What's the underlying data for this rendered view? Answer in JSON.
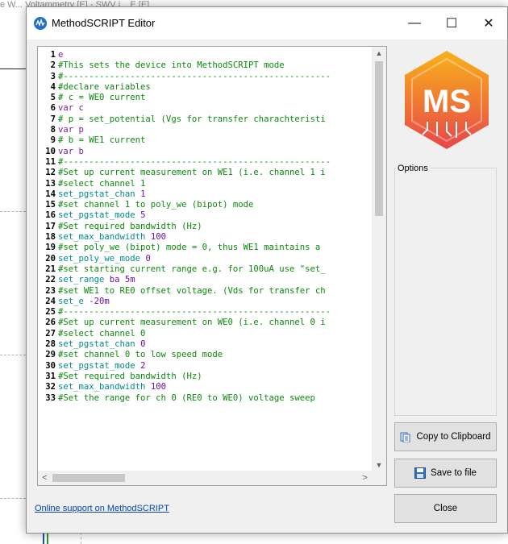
{
  "background": {
    "top_text": "e W... Voltammetry [E] - SWV i... E [E]"
  },
  "window": {
    "title": "MethodSCRIPT Editor",
    "controls": {
      "minimize": "—",
      "maximize": "☐",
      "close": "✕"
    }
  },
  "editor": {
    "lines": [
      {
        "n": "1",
        "text": "e",
        "kind": "plain"
      },
      {
        "n": "2",
        "text": "#This sets the device into MethodSCRIPT mode",
        "kind": "comment"
      },
      {
        "n": "3",
        "text": "#----------------------------------------------------",
        "kind": "comment"
      },
      {
        "n": "4",
        "text": "#declare variables",
        "kind": "comment"
      },
      {
        "n": "5",
        "text": "# c = WE0 current",
        "kind": "comment"
      },
      {
        "n": "6",
        "text": "var c",
        "kind": "var"
      },
      {
        "n": "7",
        "text": "# p = set_potential (Vgs for transfer charachteristi",
        "kind": "comment"
      },
      {
        "n": "8",
        "text": "var p",
        "kind": "var"
      },
      {
        "n": "9",
        "text": "# b = WE1 current",
        "kind": "comment"
      },
      {
        "n": "10",
        "text": "var b",
        "kind": "var"
      },
      {
        "n": "11",
        "text": "#----------------------------------------------------",
        "kind": "comment"
      },
      {
        "n": "12",
        "text": "#Set up current measurement on WE1 (i.e. channel 1 i",
        "kind": "comment"
      },
      {
        "n": "13",
        "text": "#select channel 1",
        "kind": "comment"
      },
      {
        "n": "14",
        "cmd": "set_pgstat_chan",
        "arg": "1",
        "kind": "cmd"
      },
      {
        "n": "15",
        "text": "#set channel 1 to poly_we (bipot) mode",
        "kind": "comment"
      },
      {
        "n": "16",
        "cmd": "set_pgstat_mode",
        "arg": "5",
        "kind": "cmd"
      },
      {
        "n": "17",
        "text": "#Set required bandwidth (Hz)",
        "kind": "comment"
      },
      {
        "n": "18",
        "cmd": "set_max_bandwidth",
        "arg": "100",
        "kind": "cmd"
      },
      {
        "n": "19",
        "text": "#set poly_we (bipot) mode = 0, thus WE1 maintains a",
        "kind": "comment"
      },
      {
        "n": "20",
        "cmd": "set_poly_we_mode",
        "arg": "0",
        "kind": "cmd"
      },
      {
        "n": "21",
        "text": "#set starting current range e.g. for 100uA use \"set_",
        "kind": "comment"
      },
      {
        "n": "22",
        "cmd": "set_range",
        "arg": "ba 5m",
        "kind": "cmd"
      },
      {
        "n": "23",
        "text": "#set WE1 to RE0 offset voltage. (Vds for transfer ch",
        "kind": "comment"
      },
      {
        "n": "24",
        "cmd": "set_e",
        "arg": "-20m",
        "kind": "cmd"
      },
      {
        "n": "25",
        "text": "#----------------------------------------------------",
        "kind": "comment"
      },
      {
        "n": "26",
        "text": "#Set up current measurement on WE0 (i.e. channel 0 i",
        "kind": "comment"
      },
      {
        "n": "27",
        "text": "#select channel 0",
        "kind": "comment"
      },
      {
        "n": "28",
        "cmd": "set_pgstat_chan",
        "arg": "0",
        "kind": "cmd"
      },
      {
        "n": "29",
        "text": "#set channel 0 to low speed mode",
        "kind": "comment"
      },
      {
        "n": "30",
        "cmd": "set_pgstat_mode",
        "arg": "2",
        "kind": "cmd"
      },
      {
        "n": "31",
        "text": "#Set required bandwidth (Hz)",
        "kind": "comment"
      },
      {
        "n": "32",
        "cmd": "set_max_bandwidth",
        "arg": "100",
        "kind": "cmd"
      },
      {
        "n": "33",
        "text": "#Set the range for ch 0 (RE0 to WE0) voltage sweep",
        "kind": "comment"
      }
    ],
    "scroll": {
      "up": "▲",
      "down": "▼",
      "left": "<",
      "right": ">"
    }
  },
  "logo": {
    "text": "MS",
    "color_top": "#f7b21a",
    "color_bottom": "#e8454a",
    "accent": "#ef8a1e"
  },
  "options": {
    "label": "Options"
  },
  "buttons": {
    "copy": "Copy to Clipboard",
    "save": "Save to file",
    "close": "Close"
  },
  "link": {
    "text": "Online support on MethodSCRIPT"
  },
  "icons": {
    "app": "methodscript-app-icon",
    "copy": "clipboard-icon",
    "save": "floppy-disk-icon"
  },
  "colors": {
    "comment": "#0a8a0a",
    "command": "#008b8b",
    "variable": "#7b1fa2",
    "link": "#0645ad"
  }
}
